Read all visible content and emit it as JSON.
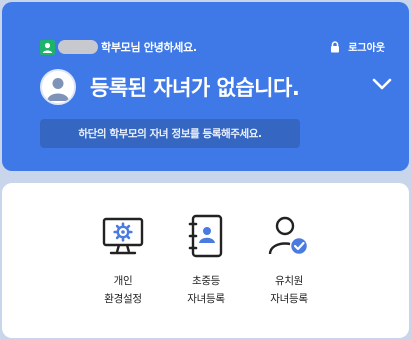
{
  "header": {
    "greeting_suffix": "학부모님 안녕하세요.",
    "logout_label": "로그아웃",
    "title": "등록된 자녀가 없습니다.",
    "notice": "하단의 학부모의 자녀 정보를 등록해주세요."
  },
  "menu": {
    "items": [
      {
        "line1": "개인",
        "line2": "환경설정",
        "icon": "monitor-gear-icon"
      },
      {
        "line1": "초중등",
        "line2": "자녀등록",
        "icon": "address-book-icon"
      },
      {
        "line1": "유치원",
        "line2": "자녀등록",
        "icon": "user-check-icon"
      }
    ]
  },
  "colors": {
    "header_blue": "#3f79e8",
    "notice_blue": "#3566c2",
    "user_badge_green": "#1fb36a",
    "icon_accent": "#4a7be0"
  }
}
